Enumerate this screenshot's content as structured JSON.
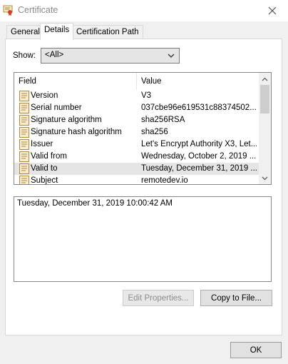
{
  "window": {
    "title": "Certificate"
  },
  "tabs": [
    {
      "label": "General"
    },
    {
      "label": "Details"
    },
    {
      "label": "Certification Path"
    }
  ],
  "show": {
    "label": "Show:",
    "selected": "<All>"
  },
  "list": {
    "headers": {
      "field": "Field",
      "value": "Value"
    },
    "rows": [
      {
        "field": "Version",
        "value": "V3"
      },
      {
        "field": "Serial number",
        "value": "037cbe96e619531c88374502..."
      },
      {
        "field": "Signature algorithm",
        "value": "sha256RSA"
      },
      {
        "field": "Signature hash algorithm",
        "value": "sha256"
      },
      {
        "field": "Issuer",
        "value": "Let's Encrypt Authority X3, Let..."
      },
      {
        "field": "Valid from",
        "value": "Wednesday, October 2, 2019 ..."
      },
      {
        "field": "Valid to",
        "value": "Tuesday, December 31, 2019 ...",
        "selected": true
      },
      {
        "field": "Subject",
        "value": "remotedev.io"
      }
    ]
  },
  "detail": {
    "text": "Tuesday, December 31, 2019 10:00:42 AM"
  },
  "buttons": {
    "edit_properties": "Edit Properties...",
    "copy_to_file": "Copy to File...",
    "ok": "OK"
  },
  "colors": {
    "selection": "#e5e5e5",
    "accent": "#0078d7"
  }
}
